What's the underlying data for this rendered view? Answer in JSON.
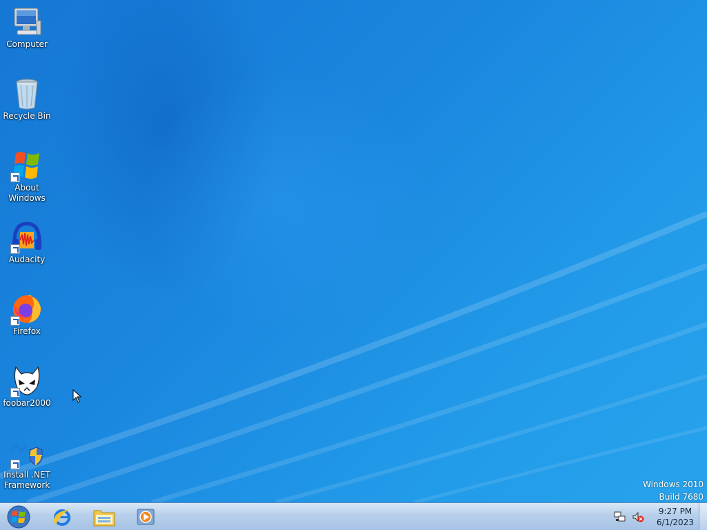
{
  "desktop": {
    "icons": [
      {
        "label": "Computer"
      },
      {
        "label": "Recycle Bin"
      },
      {
        "label": "About Windows"
      },
      {
        "label": "Audacity"
      },
      {
        "label": "Firefox"
      },
      {
        "label": "foobar2000"
      },
      {
        "label": "Install .NET Framework"
      }
    ],
    "watermark": {
      "line1": "Windows 2010",
      "line2": "Build 7680"
    }
  },
  "taskbar": {
    "start_icon": "windows-logo-icon",
    "pinned": [
      {
        "name": "Internet Explorer",
        "icon": "internet-explorer-icon"
      },
      {
        "name": "Windows Explorer",
        "icon": "folder-icon"
      },
      {
        "name": "Media Player",
        "icon": "media-player-icon"
      }
    ],
    "tray": {
      "network_icon": "network-icon",
      "volume_icon": "volume-muted-icon",
      "time": "9:27 PM",
      "date": "6/1/2023"
    }
  },
  "colors": {
    "desktop": "#1a86de",
    "taskbar": "#b7cfea"
  }
}
